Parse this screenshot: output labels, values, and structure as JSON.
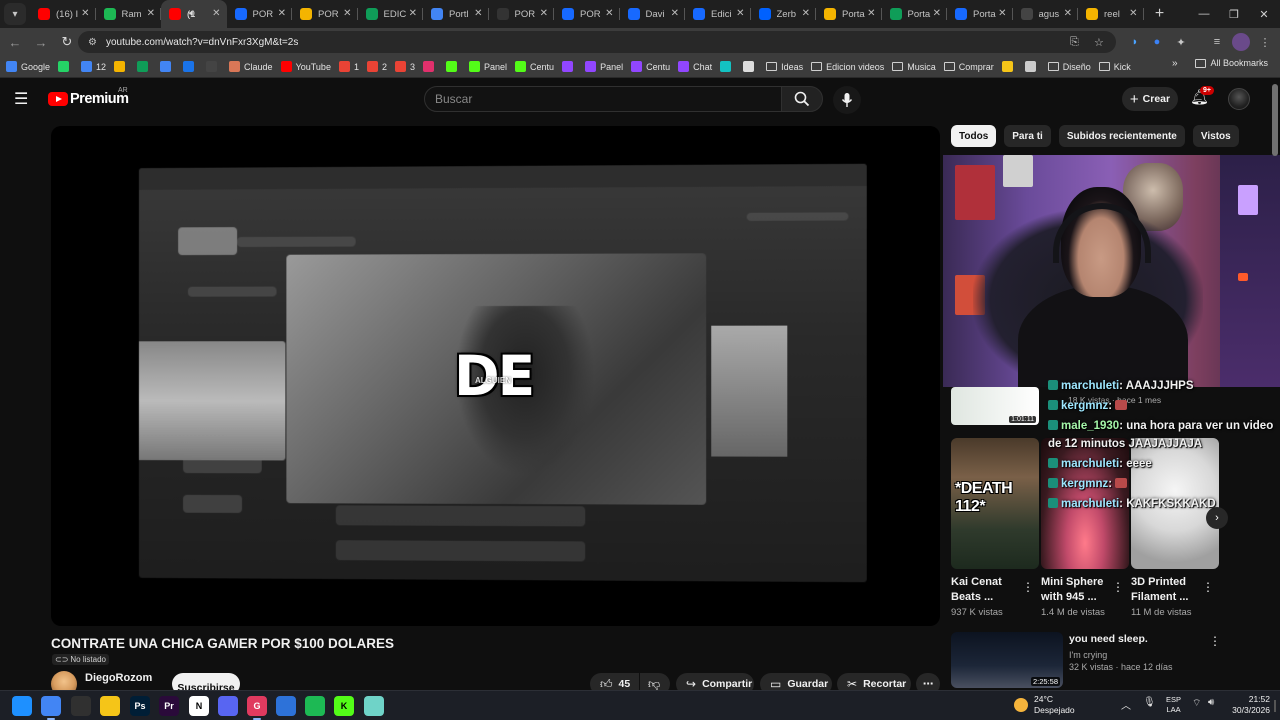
{
  "browser": {
    "tabs": [
      {
        "label": "(16) I",
        "icon": "youtube-icon",
        "color": "#ff0000",
        "active": false
      },
      {
        "label": "Ram",
        "icon": "green-app-icon",
        "color": "#1db954",
        "active": false
      },
      {
        "label": "(1",
        "icon": "youtube-icon",
        "color": "#ff0000",
        "active": true
      },
      {
        "label": "POR",
        "icon": "behance-icon",
        "color": "#1769ff",
        "active": false
      },
      {
        "label": "POR",
        "icon": "drive-icon",
        "color": "#f4b400",
        "active": false
      },
      {
        "label": "EDIC",
        "icon": "drive-icon",
        "color": "#0f9d58",
        "active": false
      },
      {
        "label": "Portl",
        "icon": "slides-icon",
        "color": "#4285f4",
        "active": false
      },
      {
        "label": "POR",
        "icon": "notion-icon",
        "color": "#333333",
        "active": false
      },
      {
        "label": "POR",
        "icon": "behance-icon",
        "color": "#1769ff",
        "active": false
      },
      {
        "label": "Davi",
        "icon": "behance-icon",
        "color": "#1769ff",
        "active": false
      },
      {
        "label": "Edici",
        "icon": "behance-icon",
        "color": "#1769ff",
        "active": false
      },
      {
        "label": "Zerb",
        "icon": "dropbox-icon",
        "color": "#0061ff",
        "active": false
      },
      {
        "label": "Porta",
        "icon": "drive-icon",
        "color": "#f4b400",
        "active": false
      },
      {
        "label": "Porta",
        "icon": "drive-icon",
        "color": "#0f9d58",
        "active": false
      },
      {
        "label": "Porta",
        "icon": "behance-icon",
        "color": "#1769ff",
        "active": false
      },
      {
        "label": "agus",
        "icon": "web-icon",
        "color": "#444444",
        "active": false
      },
      {
        "label": "reel",
        "icon": "drive-icon",
        "color": "#f4b400",
        "active": false
      }
    ],
    "url": "youtube.com/watch?v=dnVnFxr3XgM&t=2s",
    "bookmarks": [
      {
        "label": "Google",
        "icon": "google-icon",
        "color": "#4285f4"
      },
      {
        "label": "",
        "icon": "whatsapp-icon",
        "color": "#25d366"
      },
      {
        "label": "12",
        "icon": "calendar-icon",
        "color": "#4285f4"
      },
      {
        "label": "",
        "icon": "drive-icon",
        "color": "#f4b400"
      },
      {
        "label": "",
        "icon": "sheets-icon",
        "color": "#0f9d58"
      },
      {
        "label": "",
        "icon": "docs-icon",
        "color": "#4285f4"
      },
      {
        "label": "",
        "icon": "mail-icon",
        "color": "#1a73e8"
      },
      {
        "label": "",
        "icon": "openai-icon",
        "color": "#444444"
      },
      {
        "label": "Claude",
        "icon": "claude-icon",
        "color": "#d97757"
      },
      {
        "label": "YouTube",
        "icon": "youtube-icon",
        "color": "#ff0000"
      },
      {
        "label": "1",
        "icon": "gmail-icon",
        "color": "#ea4335"
      },
      {
        "label": "2",
        "icon": "gmail-icon",
        "color": "#ea4335"
      },
      {
        "label": "3",
        "icon": "gmail-icon",
        "color": "#ea4335"
      },
      {
        "label": "",
        "icon": "instagram-icon",
        "color": "#e1306c"
      },
      {
        "label": "",
        "icon": "kick-icon",
        "color": "#53fc18"
      },
      {
        "label": "Panel",
        "icon": "kick-icon",
        "color": "#53fc18"
      },
      {
        "label": "Centu",
        "icon": "kick-icon",
        "color": "#53fc18"
      },
      {
        "label": "",
        "icon": "twitch-icon",
        "color": "#9146ff"
      },
      {
        "label": "Panel",
        "icon": "twitch-icon",
        "color": "#9146ff"
      },
      {
        "label": "Centu",
        "icon": "twitch-icon",
        "color": "#9146ff"
      },
      {
        "label": "Chat",
        "icon": "twitch-icon",
        "color": "#9146ff"
      },
      {
        "label": "",
        "icon": "app-icon",
        "color": "#13c2c2"
      },
      {
        "label": "",
        "icon": "discord-icon",
        "color": "#dddddd"
      },
      {
        "label": "Ideas",
        "icon": "folder-icon",
        "color": "#cfcfcf"
      },
      {
        "label": "Edicion videos",
        "icon": "folder-icon",
        "color": "#cfcfcf"
      },
      {
        "label": "Musica",
        "icon": "folder-icon",
        "color": "#cfcfcf"
      },
      {
        "label": "Comprar",
        "icon": "folder-icon",
        "color": "#cfcfcf"
      },
      {
        "label": "",
        "icon": "app-icon",
        "color": "#f5c518"
      },
      {
        "label": "",
        "icon": "app-icon",
        "color": "#cccccc"
      },
      {
        "label": "Diseño",
        "icon": "folder-icon",
        "color": "#cfcfcf"
      },
      {
        "label": "Kick",
        "icon": "folder-icon",
        "color": "#cfcfcf"
      }
    ],
    "all_bookmarks": "All Bookmarks"
  },
  "youtube": {
    "brand": "Premium",
    "country": "AR",
    "search_placeholder": "Buscar",
    "create_label": "Crear",
    "notif_count": "9+",
    "video": {
      "caption": "DE",
      "caption_sub": "ALGUIEN",
      "title": "CONTRATE UNA CHICA GAMER POR $100 DOLARES",
      "privacy": "No listado",
      "channel": "DiegoRozom",
      "subscribe": "Suscribirse",
      "likes": "45",
      "share": "Compartir",
      "save": "Guardar",
      "clip": "Recortar"
    },
    "chips": [
      "Todos",
      "Para ti",
      "Subidos recientemente",
      "Vistos"
    ],
    "chat": [
      {
        "user": "marchuleti",
        "msg": ": AAAJJJHPS",
        "green": false
      },
      {
        "user": "kergmnz",
        "msg": ":",
        "green": false,
        "emote": true
      },
      {
        "user": "male_1930",
        "msg": ": una hora para ver un video",
        "green": true
      },
      {
        "user": "",
        "msg": "de 12 minutos JAAJAJJAJA",
        "green": false
      },
      {
        "user": "marchuleti",
        "msg": ": eeee",
        "green": false
      },
      {
        "user": "kergmnz",
        "msg": ":",
        "green": false,
        "emote": true
      },
      {
        "user": "marchuleti",
        "msg": ": KAKFKSKKAKD",
        "green": false
      }
    ],
    "rec_top": {
      "duration": "1:01:11",
      "meta": "18 K vistas · hace 1 mes"
    },
    "shorts": [
      {
        "title": "Kai Cenat Beats ...",
        "views": "937 K vistas",
        "overlay": "*DEATH 112*"
      },
      {
        "title": "Mini Sphere with 945 ...",
        "views": "1.4 M de vistas",
        "overlay": ""
      },
      {
        "title": "3D Printed Filament ...",
        "views": "11 M de vistas",
        "overlay": ""
      }
    ],
    "rec_bottom": {
      "title": "you need sleep.",
      "channel": "I'm crying",
      "meta": "32 K vistas · hace 12 días",
      "duration": "2:25:58"
    }
  },
  "taskbar": {
    "apps": [
      {
        "name": "start-icon",
        "label": "",
        "color": "#1e90ff"
      },
      {
        "name": "chrome-icon",
        "label": "",
        "color": "#4285f4"
      },
      {
        "name": "obs-icon",
        "label": "",
        "color": "#303030"
      },
      {
        "name": "explorer-icon",
        "label": "",
        "color": "#f5c518"
      },
      {
        "name": "photoshop-icon",
        "label": "Ps",
        "color": "#001e36"
      },
      {
        "name": "premiere-icon",
        "label": "Pr",
        "color": "#2a0a3a"
      },
      {
        "name": "notion-icon",
        "label": "N",
        "color": "#ffffff"
      },
      {
        "name": "discord-icon",
        "label": "",
        "color": "#5865f2"
      },
      {
        "name": "gapp-icon",
        "label": "G",
        "color": "#e03a5f"
      },
      {
        "name": "vpn-icon",
        "label": "",
        "color": "#2d72d9"
      },
      {
        "name": "spotify-icon",
        "label": "",
        "color": "#1db954"
      },
      {
        "name": "kick-icon",
        "label": "K",
        "color": "#53fc18"
      },
      {
        "name": "notes-icon",
        "label": "",
        "color": "#6fd3c8"
      }
    ],
    "weather_temp": "24°C",
    "weather_desc": "Despejado",
    "lang_top": "ESP",
    "lang_bottom": "LAA",
    "time": "21:52",
    "date": "30/3/2026"
  }
}
